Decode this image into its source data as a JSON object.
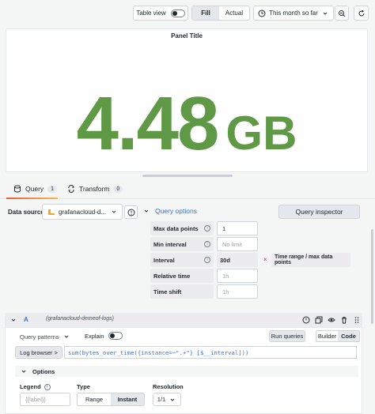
{
  "toolbar": {
    "table_view_label": "Table view",
    "fill_label": "Fill",
    "actual_label": "Actual",
    "time_range_label": "This month so far"
  },
  "panel": {
    "title": "Panel Title",
    "value": "4.48",
    "unit": "GB",
    "value_color": "#5f9945"
  },
  "tabs": [
    {
      "label": "Query",
      "count": "1"
    },
    {
      "label": "Transform",
      "count": "0"
    }
  ],
  "data_source": {
    "label": "Data source",
    "selected": "grafanacloud-d..."
  },
  "query_options": {
    "title": "Query options",
    "inspector_label": "Query inspector",
    "rows": [
      {
        "label": "Max data points",
        "value": "1",
        "placeholder": ""
      },
      {
        "label": "Min interval",
        "value": "",
        "placeholder": "No limit"
      },
      {
        "label": "Interval",
        "value": "30d",
        "placeholder": ""
      },
      {
        "label": "Relative time",
        "value": "",
        "placeholder": "1h"
      },
      {
        "label": "Time shift",
        "value": "",
        "placeholder": "1h"
      }
    ],
    "interval_note_x": "×",
    "interval_note": "Time range / max data points"
  },
  "query": {
    "ref_id": "A",
    "datasource_name": "(grafanacloud-demeof-logs)",
    "patterns_label": "Query patterns",
    "explain_label": "Explain",
    "run_label": "Run queries",
    "builder_label": "Builder",
    "code_label": "Code",
    "log_browser_label": "Log browser >",
    "expression": "sum(bytes_over_time({instance=~\".+\"} [$__interval]))",
    "options_title": "Options",
    "legend_label": "Legend",
    "legend_placeholder": "{{label}}",
    "type_label": "Type",
    "type_range": "Range",
    "type_instant": "Instant",
    "resolution_label": "Resolution",
    "resolution_value": "1/1"
  },
  "colors": {
    "accent_blue": "#3871dc",
    "value_green": "#5f9945",
    "tab_underline_start": "#f55f3e",
    "tab_underline_end": "#ffb357"
  },
  "icons": [
    "clock-icon",
    "chevron-down-icon",
    "zoom-out-icon",
    "refresh-icon",
    "database-icon",
    "transform-icon",
    "info-icon",
    "help-icon",
    "copy-icon",
    "eye-icon",
    "trash-icon",
    "drag-icon"
  ]
}
